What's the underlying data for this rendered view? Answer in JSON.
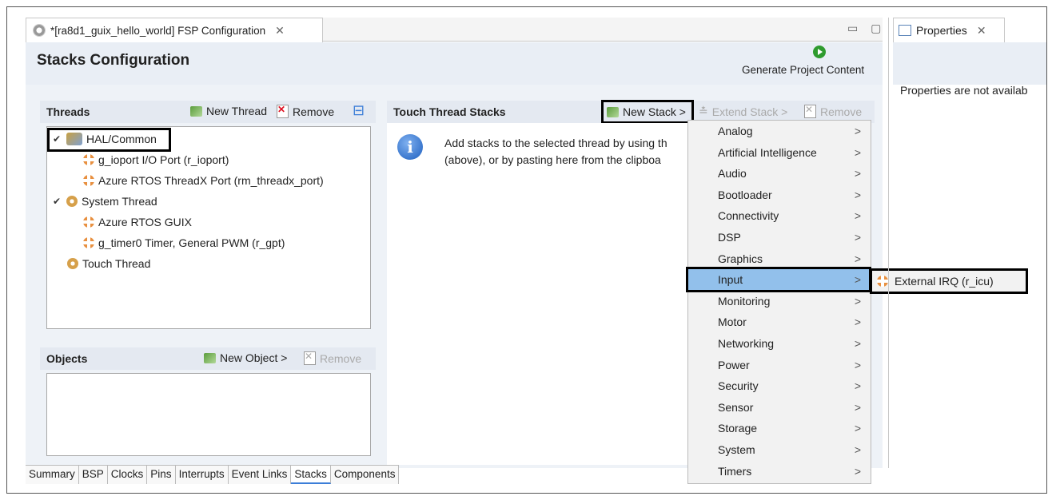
{
  "editor": {
    "tab_title": "*[ra8d1_guix_hello_world] FSP Configuration",
    "close_glyph": "✕",
    "window_controls": "▭ ▢",
    "page_title": "Stacks Configuration",
    "generate_label": "Generate Project Content"
  },
  "threads": {
    "title": "Threads",
    "new_thread": "New Thread",
    "remove": "Remove",
    "collapse_glyph": "⊟",
    "items": [
      {
        "label": "HAL/Common",
        "icon": "hal-icon",
        "expanded": true
      },
      {
        "label": "g_ioport I/O Port (r_ioport)",
        "icon": "driver-icon"
      },
      {
        "label": "Azure RTOS ThreadX Port (rm_threadx_port)",
        "icon": "driver-icon"
      },
      {
        "label": "System Thread",
        "icon": "thread-icon",
        "expanded": true
      },
      {
        "label": "Azure RTOS GUIX",
        "icon": "driver-icon"
      },
      {
        "label": "g_timer0 Timer, General PWM (r_gpt)",
        "icon": "driver-icon"
      },
      {
        "label": "Touch Thread",
        "icon": "thread-icon"
      }
    ]
  },
  "objects": {
    "title": "Objects",
    "new_object": "New Object >",
    "remove": "Remove"
  },
  "stacks": {
    "title": "Touch Thread Stacks",
    "new_stack": "New Stack >",
    "extend_stack": "Extend Stack >",
    "remove": "Remove",
    "info_line1": "Add stacks to the selected thread by using th",
    "info_line2": "(above), or by pasting here from the clipboa"
  },
  "menu": {
    "items": [
      "Analog",
      "Artificial Intelligence",
      "Audio",
      "Bootloader",
      "Connectivity",
      "DSP",
      "Graphics",
      "Input",
      "Monitoring",
      "Motor",
      "Networking",
      "Power",
      "Security",
      "Sensor",
      "Storage",
      "System",
      "Timers"
    ],
    "selected": "Input",
    "arrow": ">",
    "submenu_item": "External IRQ (r_icu)"
  },
  "bottom_tabs": [
    "Summary",
    "BSP",
    "Clocks",
    "Pins",
    "Interrupts",
    "Event Links",
    "Stacks",
    "Components"
  ],
  "active_bottom_tab": "Stacks",
  "properties": {
    "tab_label": "Properties",
    "message": "Properties are not availab"
  },
  "colors": {
    "accent": "#92c0eb",
    "header": "#e9eef5"
  }
}
